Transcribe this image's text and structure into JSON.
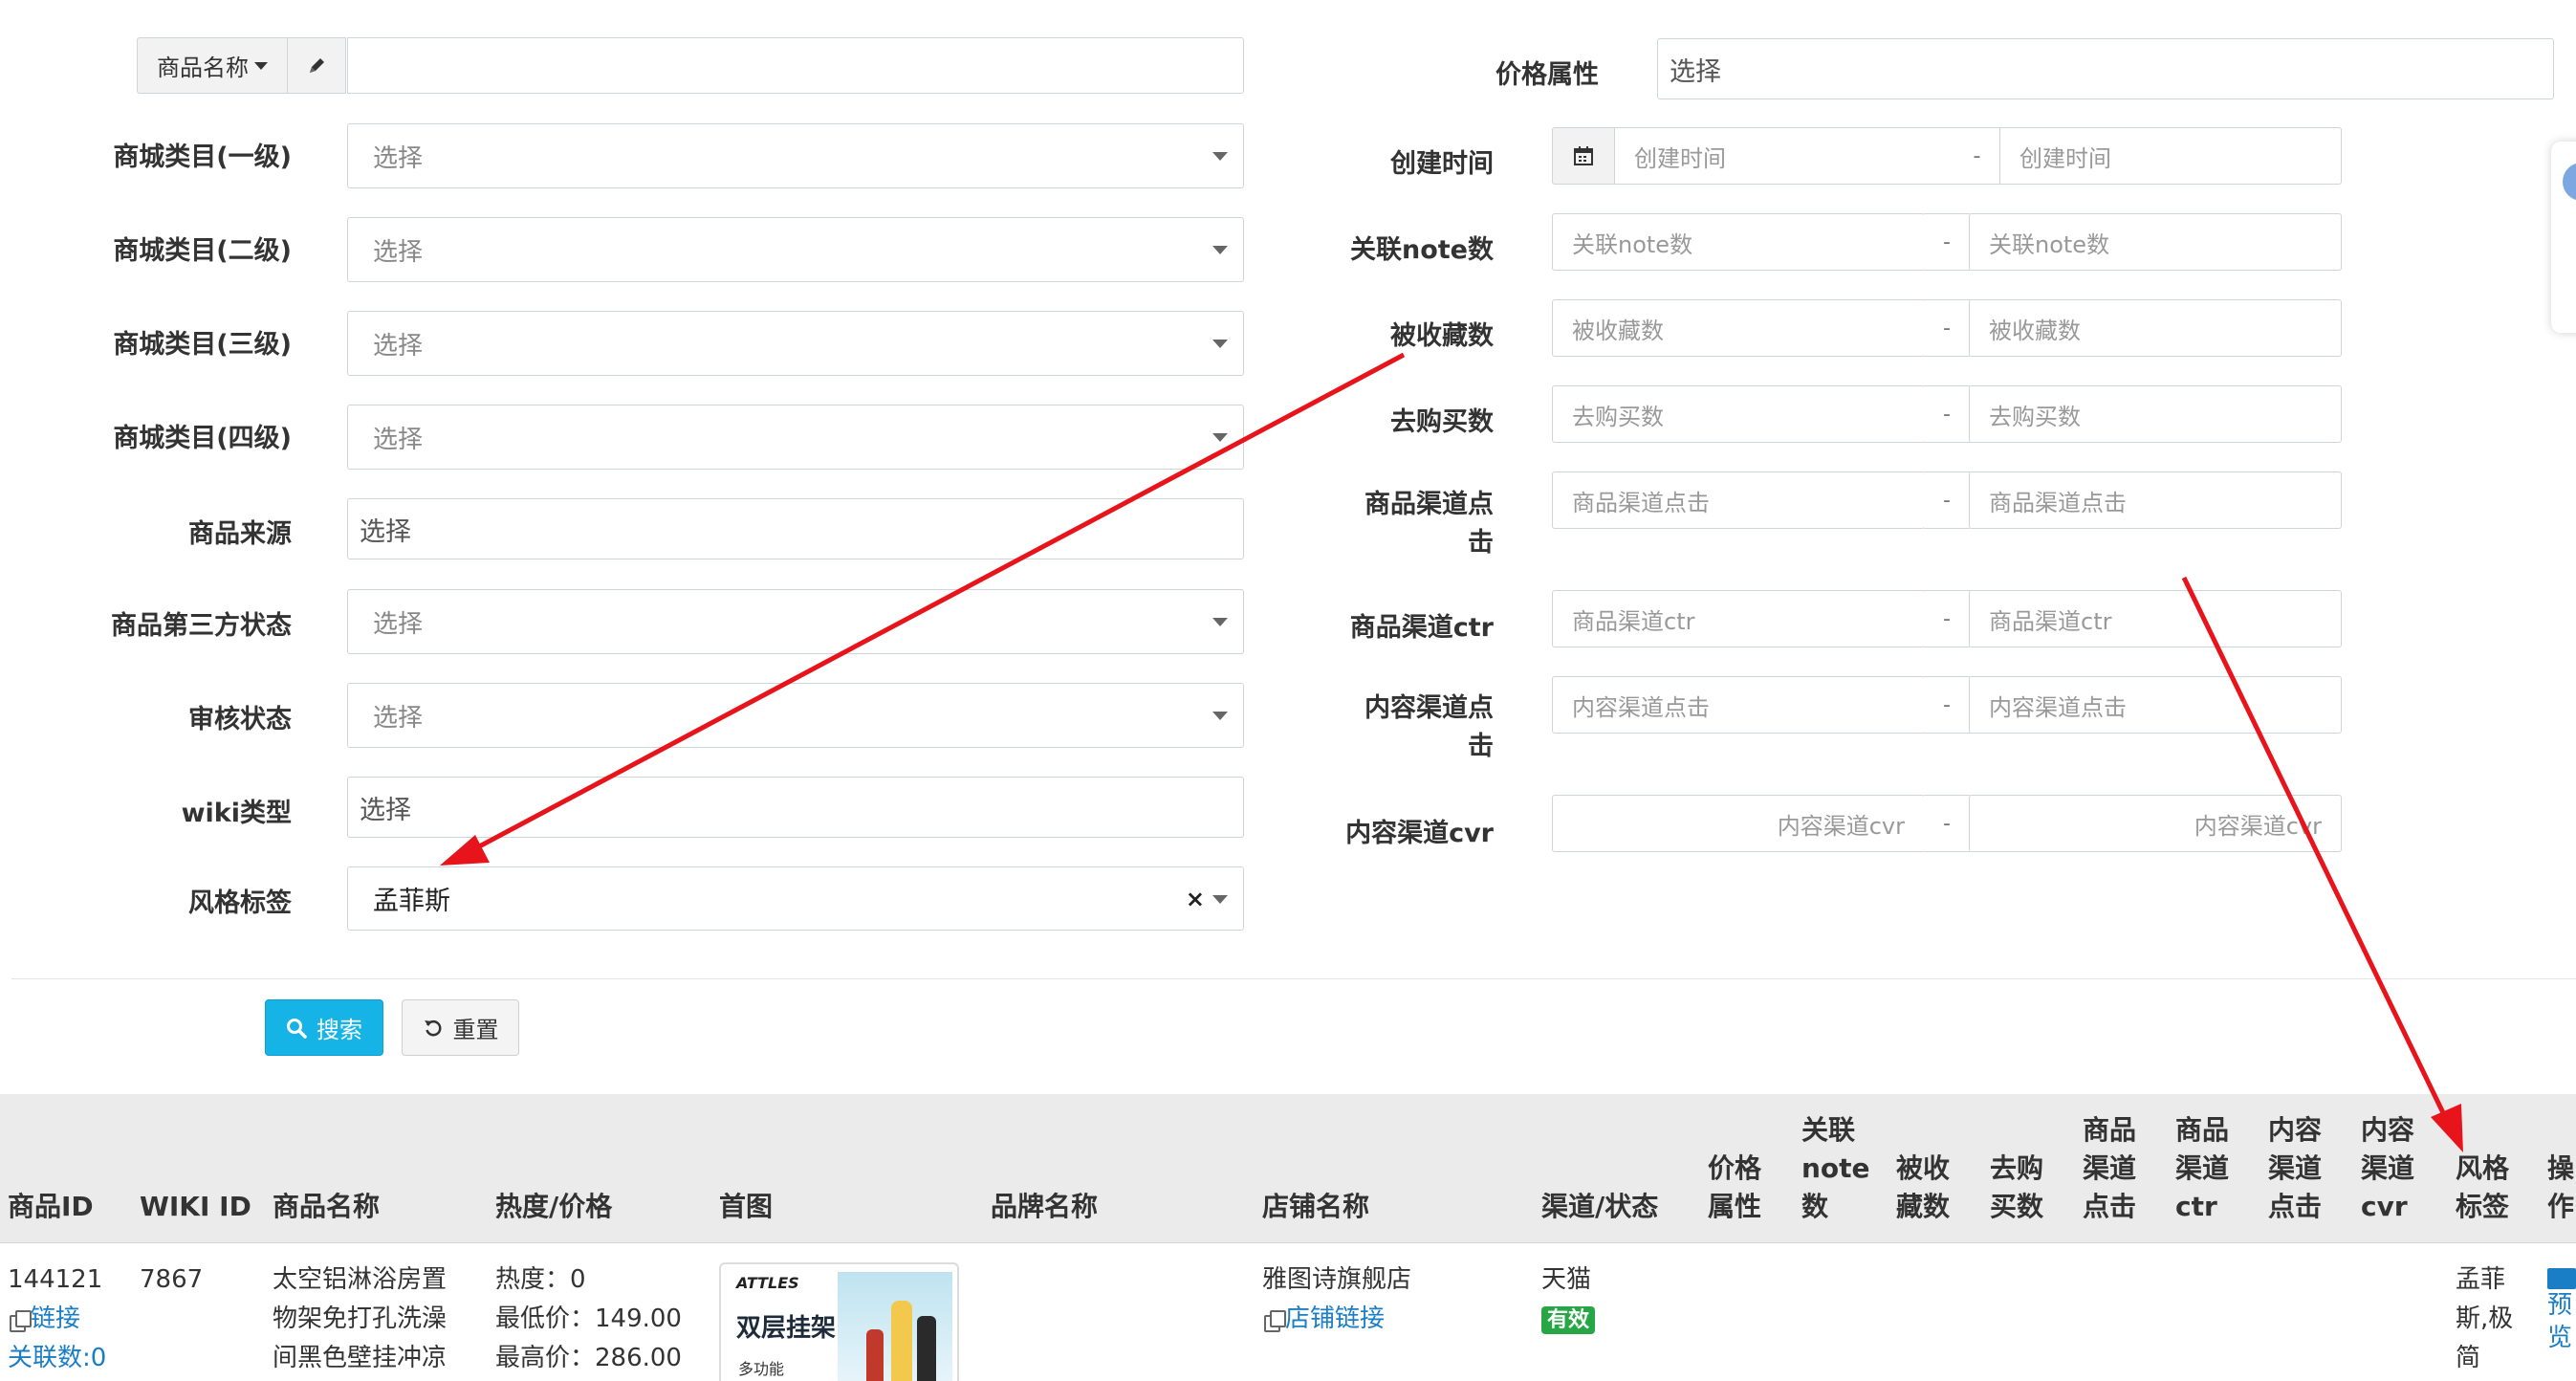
{
  "left_form": {
    "name_field": {
      "dropdown_label": "商品名称",
      "value": ""
    },
    "rows": [
      {
        "label": "商城类目(一级)",
        "placeholder": "选择"
      },
      {
        "label": "商城类目(二级)",
        "placeholder": "选择"
      },
      {
        "label": "商城类目(三级)",
        "placeholder": "选择"
      },
      {
        "label": "商城类目(四级)",
        "placeholder": "选择"
      },
      {
        "label": "商品来源",
        "placeholder": "选择"
      },
      {
        "label": "商品第三方状态",
        "placeholder": "选择"
      },
      {
        "label": "审核状态",
        "placeholder": "选择"
      },
      {
        "label": "wiki类型",
        "placeholder": "选择"
      },
      {
        "label": "风格标签",
        "value": "孟菲斯"
      }
    ]
  },
  "right_form": {
    "price_attr": {
      "label": "价格属性",
      "placeholder": "选择"
    },
    "ranges": [
      {
        "label": "创建时间",
        "from": "创建时间",
        "to": "创建时间"
      },
      {
        "label": "关联note数",
        "from": "关联note数",
        "to": "关联note数"
      },
      {
        "label": "被收藏数",
        "from": "被收藏数",
        "to": "被收藏数"
      },
      {
        "label": "去购买数",
        "from": "去购买数",
        "to": "去购买数"
      },
      {
        "label_line1": "商品渠道点",
        "label_line2": "击",
        "from": "商品渠道点击",
        "to": "商品渠道点击"
      },
      {
        "label": "商品渠道ctr",
        "from": "商品渠道ctr",
        "to": "商品渠道ctr"
      },
      {
        "label_line1": "内容渠道点",
        "label_line2": "击",
        "from": "内容渠道点击",
        "to": "内容渠道点击"
      },
      {
        "label": "内容渠道cvr",
        "from": "内容渠道cvr",
        "to": "内容渠道cvr"
      }
    ],
    "range_separator": "-"
  },
  "buttons": {
    "search": "搜索",
    "reset": "重置"
  },
  "table": {
    "headers": {
      "id": "商品ID",
      "wiki": "WIKI ID",
      "name": "商品名称",
      "heat": "热度/价格",
      "image": "首图",
      "brand": "品牌名称",
      "shop": "店铺名称",
      "channel": "渠道/状态",
      "price_attr": [
        "价格",
        "属性"
      ],
      "note": [
        "关联",
        "note",
        "数"
      ],
      "fav": [
        "被收",
        "藏数"
      ],
      "buy": [
        "去购",
        "买数"
      ],
      "pclick": [
        "商品",
        "渠道",
        "点击"
      ],
      "pctr": [
        "商品",
        "渠道",
        "ctr"
      ],
      "cclick": [
        "内容",
        "渠道",
        "点击"
      ],
      "ccvr": [
        "内容",
        "渠道",
        "cvr"
      ],
      "style": [
        "风格",
        "标签"
      ],
      "op": [
        "操",
        "作"
      ]
    },
    "row": {
      "id": "144121",
      "link": "链接",
      "related": "关联数:0",
      "wiki": "7867",
      "name_lines": [
        "太空铝淋浴房置",
        "物架免打孔洗澡",
        "间黑色壁挂冲凉"
      ],
      "heat": "热度：0",
      "min_price": "最低价：149.00",
      "max_price": "最高价：286.00",
      "image": {
        "brand": "ATTLES",
        "title": "双层挂架",
        "sub": "多功能"
      },
      "shop": "雅图诗旗舰店",
      "shop_link": "店铺链接",
      "channel": "天猫",
      "status": "有效",
      "style_lines": [
        "孟菲",
        "斯,极",
        "简"
      ],
      "op_lines": [
        "预",
        "览"
      ]
    }
  },
  "colors": {
    "primary": "#16b4e6",
    "annotation": "#e8141b",
    "status_green": "#27a744",
    "link": "#1a7ec7"
  }
}
